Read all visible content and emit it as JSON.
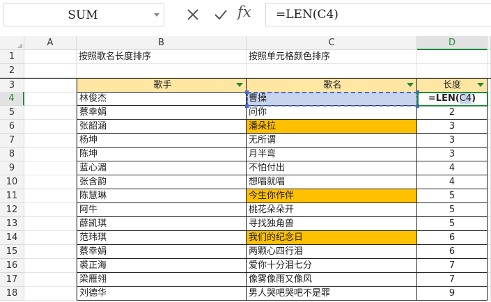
{
  "formula_bar": {
    "name_box": "SUM",
    "fx_label": "fx",
    "formula": "=LEN(C4)"
  },
  "columns": [
    "A",
    "B",
    "C",
    "D"
  ],
  "cells": {
    "B1": "按照歌名长度排序",
    "C1": "按照单元格颜色排序",
    "B3": "歌手",
    "C3": "歌名",
    "D3": "长度",
    "D4_prefix": "=LEN(",
    "D4_ref": "C4",
    "D4_suffix": ")"
  },
  "row_numbers": [
    "1",
    "2",
    "3",
    "4",
    "5",
    "6",
    "7",
    "8",
    "9",
    "10",
    "11",
    "12",
    "13",
    "14",
    "15",
    "16",
    "17",
    "18"
  ],
  "table_rows": [
    {
      "singer": "林俊杰",
      "song": "曹操",
      "length": ""
    },
    {
      "singer": "蔡幸娟",
      "song": "问你",
      "length": "2"
    },
    {
      "singer": "张韶涵",
      "song": "潘朵拉",
      "length": "3"
    },
    {
      "singer": "杨坤",
      "song": "无所谓",
      "length": "3"
    },
    {
      "singer": "陈坤",
      "song": "月半弯",
      "length": "3"
    },
    {
      "singer": "蓝心湄",
      "song": "不怕付出",
      "length": "4"
    },
    {
      "singer": "张含韵",
      "song": "想唱就唱",
      "length": "4"
    },
    {
      "singer": "陈慧琳",
      "song": "今生你作伴",
      "length": "5"
    },
    {
      "singer": "阿牛",
      "song": "桃花朵朵开",
      "length": "5"
    },
    {
      "singer": "薛凯琪",
      "song": "寻找独角兽",
      "length": "5"
    },
    {
      "singer": "范玮琪",
      "song": "我们的纪念日",
      "length": "6"
    },
    {
      "singer": "蔡幸娟",
      "song": "两颗心四行泪",
      "length": "6"
    },
    {
      "singer": "裘正海",
      "song": "爱你十分泪七分",
      "length": "7"
    },
    {
      "singer": "梁雁翎",
      "song": "像雾像雨又像风",
      "length": "7"
    },
    {
      "singer": "刘德华",
      "song": "男人哭吧哭吧不是罪",
      "length": "9"
    }
  ],
  "colors": {
    "header_fill": "#ffe7a3",
    "highlight_fill": "#ffc000",
    "selection_fill": "#c8d3ee",
    "active_green": "#1e8a3c"
  }
}
